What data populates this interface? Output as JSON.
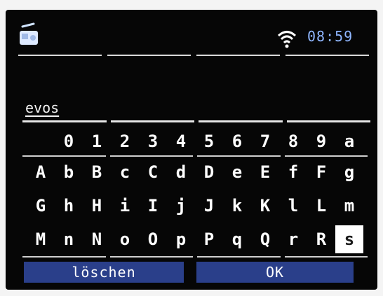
{
  "status": {
    "time": "08:59",
    "icons": [
      "radio-icon",
      "wifi-icon"
    ]
  },
  "input": {
    "value": "evos"
  },
  "keyboard": {
    "rows": [
      [
        "0",
        "1",
        "2",
        "3",
        "4",
        "5",
        "6",
        "7",
        "8",
        "9",
        "a"
      ],
      [
        "A",
        "b",
        "B",
        "c",
        "C",
        "d",
        "D",
        "e",
        "E",
        "f",
        "F",
        "g"
      ],
      [
        "G",
        "h",
        "H",
        "i",
        "I",
        "j",
        "J",
        "k",
        "K",
        "l",
        "L",
        "m"
      ],
      [
        "M",
        "n",
        "N",
        "o",
        "O",
        "p",
        "P",
        "q",
        "Q",
        "r",
        "R",
        "s"
      ]
    ],
    "selected_key": "s"
  },
  "buttons": {
    "delete_label": "löschen",
    "ok_label": "OK"
  },
  "colors": {
    "screen_bg": "#060606",
    "clock": "#8fb6ff",
    "button_bg": "#2a3f8a",
    "selected_key_bg": "#ffffff"
  }
}
